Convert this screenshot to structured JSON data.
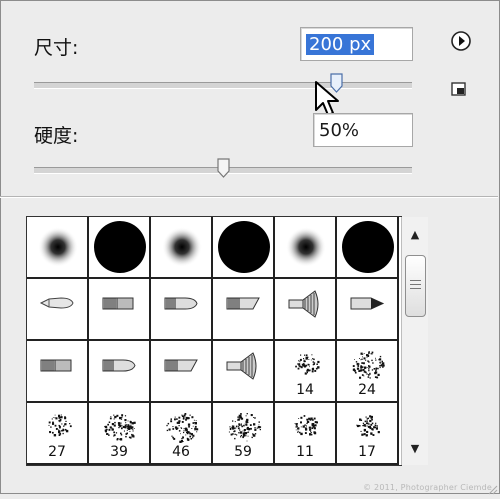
{
  "size": {
    "label": "尺寸:",
    "value": "200 px",
    "slider_fraction": 0.8
  },
  "hardness": {
    "label": "硬度:",
    "value": "50%",
    "slider_fraction": 0.5
  },
  "brushes": [
    {
      "kind": "soft",
      "number": ""
    },
    {
      "kind": "hard",
      "number": ""
    },
    {
      "kind": "soft",
      "number": ""
    },
    {
      "kind": "hard",
      "number": ""
    },
    {
      "kind": "soft",
      "number": ""
    },
    {
      "kind": "hard",
      "number": ""
    },
    {
      "kind": "tip-round",
      "number": ""
    },
    {
      "kind": "tip-flat",
      "number": ""
    },
    {
      "kind": "tip-bullet",
      "number": ""
    },
    {
      "kind": "tip-angle",
      "number": ""
    },
    {
      "kind": "tip-fan",
      "number": ""
    },
    {
      "kind": "tip-point",
      "number": ""
    },
    {
      "kind": "tip-flat",
      "number": ""
    },
    {
      "kind": "tip-bullet",
      "number": ""
    },
    {
      "kind": "tip-angle",
      "number": ""
    },
    {
      "kind": "tip-fan",
      "number": ""
    },
    {
      "kind": "scatter",
      "number": "14"
    },
    {
      "kind": "scatter",
      "number": "24"
    },
    {
      "kind": "scatter",
      "number": "27"
    },
    {
      "kind": "scatter",
      "number": "39"
    },
    {
      "kind": "scatter",
      "number": "46"
    },
    {
      "kind": "scatter",
      "number": "59"
    },
    {
      "kind": "scatter",
      "number": "11"
    },
    {
      "kind": "scatter",
      "number": "17"
    }
  ],
  "scrollbar": {
    "up": "▲",
    "down": "▼"
  },
  "icons": {
    "menu": "play-circle-icon",
    "new_preset": "new-preset-icon"
  },
  "watermark": "© 2011, Photographer Ciemde",
  "colors": {
    "selection": "#3875d7",
    "panel": "#ececec"
  }
}
